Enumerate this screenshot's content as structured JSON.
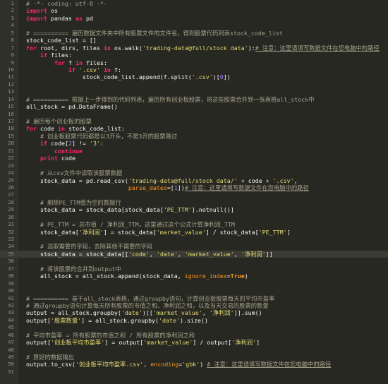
{
  "editor": {
    "colors": {
      "background": "#272822",
      "keyword": "#f92672",
      "string": "#e6db74",
      "comment": "#a6a28c",
      "number": "#ae81ff",
      "param": "#fd971f"
    },
    "lines": [
      {
        "n": "1",
        "t": [
          {
            "k": "com",
            "s": "# -*- coding: utf-8 -*-"
          }
        ]
      },
      {
        "n": "2",
        "t": [
          {
            "k": "kw",
            "s": "import"
          },
          {
            "k": "plain",
            "s": " os"
          }
        ]
      },
      {
        "n": "3",
        "t": [
          {
            "k": "kw",
            "s": "import"
          },
          {
            "k": "plain",
            "s": " pandas "
          },
          {
            "k": "kw",
            "s": "as"
          },
          {
            "k": "plain",
            "s": " pd"
          }
        ]
      },
      {
        "n": "4",
        "t": []
      },
      {
        "n": "5",
        "t": [
          {
            "k": "com",
            "s": "# ========== 遍历数据文件夹中所有股票文件的文件名，得到股票代码列表stock_code_list"
          }
        ]
      },
      {
        "n": "6",
        "t": [
          {
            "k": "plain",
            "s": "stock_code_list = []"
          }
        ]
      },
      {
        "n": "7",
        "t": [
          {
            "k": "kw",
            "s": "for"
          },
          {
            "k": "plain",
            "s": " root, dirs, files "
          },
          {
            "k": "kw",
            "s": "in"
          },
          {
            "k": "plain",
            "s": " os.walk("
          },
          {
            "k": "str",
            "s": "'trading-data@full/stock data'"
          },
          {
            "k": "plain",
            "s": "):"
          },
          {
            "k": "com-ul",
            "s": "# 注意：这里请填写数据文件在您电脑中的路径"
          }
        ]
      },
      {
        "n": "8",
        "t": [
          {
            "k": "plain",
            "s": "    "
          },
          {
            "k": "kw",
            "s": "if"
          },
          {
            "k": "plain",
            "s": " files:"
          }
        ]
      },
      {
        "n": "9",
        "t": [
          {
            "k": "plain",
            "s": "        "
          },
          {
            "k": "kw",
            "s": "for"
          },
          {
            "k": "plain",
            "s": " f "
          },
          {
            "k": "kw",
            "s": "in"
          },
          {
            "k": "plain",
            "s": " files:"
          }
        ]
      },
      {
        "n": "10",
        "t": [
          {
            "k": "plain",
            "s": "            "
          },
          {
            "k": "kw",
            "s": "if"
          },
          {
            "k": "plain",
            "s": " "
          },
          {
            "k": "str",
            "s": "'.csv'"
          },
          {
            "k": "plain",
            "s": " "
          },
          {
            "k": "kw",
            "s": "in"
          },
          {
            "k": "plain",
            "s": " f:"
          }
        ]
      },
      {
        "n": "11",
        "t": [
          {
            "k": "plain",
            "s": "                stock_code_list.append(f.split("
          },
          {
            "k": "str",
            "s": "'.csv'"
          },
          {
            "k": "plain",
            "s": ")["
          },
          {
            "k": "num",
            "s": "0"
          },
          {
            "k": "plain",
            "s": "])"
          }
        ]
      },
      {
        "n": "12",
        "t": []
      },
      {
        "n": "13",
        "t": []
      },
      {
        "n": "14",
        "t": [
          {
            "k": "com",
            "s": "# ========== 根据上一步得到的代码列表，遍历所有创业板股票，将这些股票合并到一张表格all_stock中"
          }
        ]
      },
      {
        "n": "15",
        "t": [
          {
            "k": "plain",
            "s": "all_stock = pd.DataFrame()"
          }
        ]
      },
      {
        "n": "16",
        "t": []
      },
      {
        "n": "17",
        "t": [
          {
            "k": "com",
            "s": "# 遍历每个创业板的股票"
          }
        ]
      },
      {
        "n": "18",
        "t": [
          {
            "k": "kw",
            "s": "for"
          },
          {
            "k": "plain",
            "s": " code "
          },
          {
            "k": "kw",
            "s": "in"
          },
          {
            "k": "plain",
            "s": " stock_code_list:"
          }
        ]
      },
      {
        "n": "19",
        "t": [
          {
            "k": "plain",
            "s": "    "
          },
          {
            "k": "com",
            "s": "# 创业板股票代码都是以3开头，不是3开的股票跳过"
          }
        ]
      },
      {
        "n": "20",
        "t": [
          {
            "k": "plain",
            "s": "    "
          },
          {
            "k": "kw",
            "s": "if"
          },
          {
            "k": "plain",
            "s": " code["
          },
          {
            "k": "num",
            "s": "2"
          },
          {
            "k": "plain",
            "s": "] != "
          },
          {
            "k": "str",
            "s": "'3'"
          },
          {
            "k": "plain",
            "s": ":"
          }
        ]
      },
      {
        "n": "21",
        "t": [
          {
            "k": "plain",
            "s": "        "
          },
          {
            "k": "kw",
            "s": "continue"
          }
        ]
      },
      {
        "n": "22",
        "t": [
          {
            "k": "plain",
            "s": "    "
          },
          {
            "k": "kw",
            "s": "print"
          },
          {
            "k": "plain",
            "s": " code"
          }
        ]
      },
      {
        "n": "23",
        "t": []
      },
      {
        "n": "24",
        "t": [
          {
            "k": "plain",
            "s": "    "
          },
          {
            "k": "com",
            "s": "# 从csv文件中读取该股票数据"
          }
        ]
      },
      {
        "n": "25",
        "t": [
          {
            "k": "plain",
            "s": "    stock_data = pd.read_csv("
          },
          {
            "k": "str",
            "s": "'trading-data@full/stock data/'"
          },
          {
            "k": "plain",
            "s": " + code + "
          },
          {
            "k": "str",
            "s": "'.csv'"
          },
          {
            "k": "plain",
            "s": ","
          }
        ]
      },
      {
        "n": "26",
        "t": [
          {
            "k": "plain",
            "s": "                             "
          },
          {
            "k": "par",
            "s": "parse_dates"
          },
          {
            "k": "plain",
            "s": "=["
          },
          {
            "k": "num",
            "s": "1"
          },
          {
            "k": "plain",
            "s": "])"
          },
          {
            "k": "com-ul",
            "s": "# 注意：这里请填写数据文件在您电脑中的路径"
          }
        ]
      },
      {
        "n": "27",
        "t": []
      },
      {
        "n": "28",
        "t": [
          {
            "k": "plain",
            "s": "    "
          },
          {
            "k": "com",
            "s": "# 删除PE_TTM值为空的数据行"
          }
        ]
      },
      {
        "n": "29",
        "t": [
          {
            "k": "plain",
            "s": "    stock_data = stock_data[stock_data["
          },
          {
            "k": "str",
            "s": "'PE_TTM'"
          },
          {
            "k": "plain",
            "s": "].notnull()]"
          }
        ]
      },
      {
        "n": "30",
        "t": []
      },
      {
        "n": "31",
        "t": [
          {
            "k": "plain",
            "s": "    "
          },
          {
            "k": "com",
            "s": "# PE_TTM = 总市值 / 净利润_TTM，这里通过这个公式计算净利润_TTM"
          }
        ]
      },
      {
        "n": "32",
        "t": [
          {
            "k": "plain",
            "s": "    stock_data["
          },
          {
            "k": "str",
            "s": "'净利润'"
          },
          {
            "k": "plain",
            "s": "] = stock_data["
          },
          {
            "k": "str",
            "s": "'market_value'"
          },
          {
            "k": "plain",
            "s": "] / stock_data["
          },
          {
            "k": "str",
            "s": "'PE_TTM'"
          },
          {
            "k": "plain",
            "s": "]"
          }
        ]
      },
      {
        "n": "33",
        "t": []
      },
      {
        "n": "34",
        "t": [
          {
            "k": "plain",
            "s": "    "
          },
          {
            "k": "com",
            "s": "# 选取需要的字段，去除其他不需要的字段"
          }
        ]
      },
      {
        "n": "35",
        "hl": true,
        "t": [
          {
            "k": "plain",
            "s": "    stock_data = stock_data[["
          },
          {
            "k": "str",
            "s": "'code'"
          },
          {
            "k": "plain",
            "s": ", "
          },
          {
            "k": "str",
            "s": "'date'"
          },
          {
            "k": "plain",
            "s": ", "
          },
          {
            "k": "str",
            "s": "'market_value'"
          },
          {
            "k": "plain",
            "s": ", "
          },
          {
            "k": "str",
            "s": "'净利润'"
          },
          {
            "k": "plain",
            "s": "]]"
          }
        ]
      },
      {
        "n": "36",
        "t": []
      },
      {
        "n": "37",
        "t": [
          {
            "k": "plain",
            "s": "    "
          },
          {
            "k": "com",
            "s": "# 将该股票的合并到output中"
          }
        ]
      },
      {
        "n": "38",
        "t": [
          {
            "k": "plain",
            "s": "    all_stock = all_stock.append(stock_data, "
          },
          {
            "k": "par",
            "s": "ignore_index"
          },
          {
            "k": "plain",
            "s": "="
          },
          {
            "k": "kw-o",
            "s": "True"
          },
          {
            "k": "plain",
            "s": ")"
          }
        ]
      },
      {
        "n": "39",
        "t": []
      },
      {
        "n": "40",
        "t": []
      },
      {
        "n": "41",
        "t": [
          {
            "k": "com",
            "s": "# ========== 基于all_stock表格，通过groupby语句，计算创业板股票每天的平均市盈率"
          }
        ]
      },
      {
        "n": "42",
        "t": [
          {
            "k": "com",
            "s": "# 通过groupby语句计算每天所有股票的市值之和、净利润之和，以及当天交易的股票的数量"
          }
        ]
      },
      {
        "n": "43",
        "t": [
          {
            "k": "plain",
            "s": "output = all_stock.groupby("
          },
          {
            "k": "str",
            "s": "'date'"
          },
          {
            "k": "plain",
            "s": ")[["
          },
          {
            "k": "str",
            "s": "'market_value'"
          },
          {
            "k": "plain",
            "s": ", "
          },
          {
            "k": "str",
            "s": "'净利润'"
          },
          {
            "k": "plain",
            "s": "]].sum()"
          }
        ]
      },
      {
        "n": "44",
        "t": [
          {
            "k": "plain",
            "s": "output["
          },
          {
            "k": "str",
            "s": "'股票数量'"
          },
          {
            "k": "plain",
            "s": "] = all_stock.groupby("
          },
          {
            "k": "str",
            "s": "'date'"
          },
          {
            "k": "plain",
            "s": ").size()"
          }
        ]
      },
      {
        "n": "45",
        "t": []
      },
      {
        "n": "46",
        "t": [
          {
            "k": "com",
            "s": "# 平均市盈率 = 所有股票的市值之和 / 所有股票的净利润之和"
          }
        ]
      },
      {
        "n": "47",
        "t": [
          {
            "k": "plain",
            "s": "output["
          },
          {
            "k": "str",
            "s": "'创业板平均市盈率'"
          },
          {
            "k": "plain",
            "s": "] = output["
          },
          {
            "k": "str",
            "s": "'market_value'"
          },
          {
            "k": "plain",
            "s": "] / output["
          },
          {
            "k": "str",
            "s": "'净利润'"
          },
          {
            "k": "plain",
            "s": "]"
          }
        ]
      },
      {
        "n": "48",
        "t": []
      },
      {
        "n": "49",
        "t": [
          {
            "k": "com",
            "s": "# 算好的数据输出"
          }
        ]
      },
      {
        "n": "50",
        "t": [
          {
            "k": "plain",
            "s": "output.to_csv("
          },
          {
            "k": "str",
            "s": "'创业板平均市盈率.csv'"
          },
          {
            "k": "plain",
            "s": ", "
          },
          {
            "k": "par",
            "s": "encoding"
          },
          {
            "k": "plain",
            "s": "="
          },
          {
            "k": "str",
            "s": "'gbk'"
          },
          {
            "k": "plain",
            "s": ") "
          },
          {
            "k": "com-ul",
            "s": "# 注意：这里请填写数据文件在您电脑中的路径"
          }
        ]
      },
      {
        "n": "51",
        "t": []
      }
    ]
  }
}
